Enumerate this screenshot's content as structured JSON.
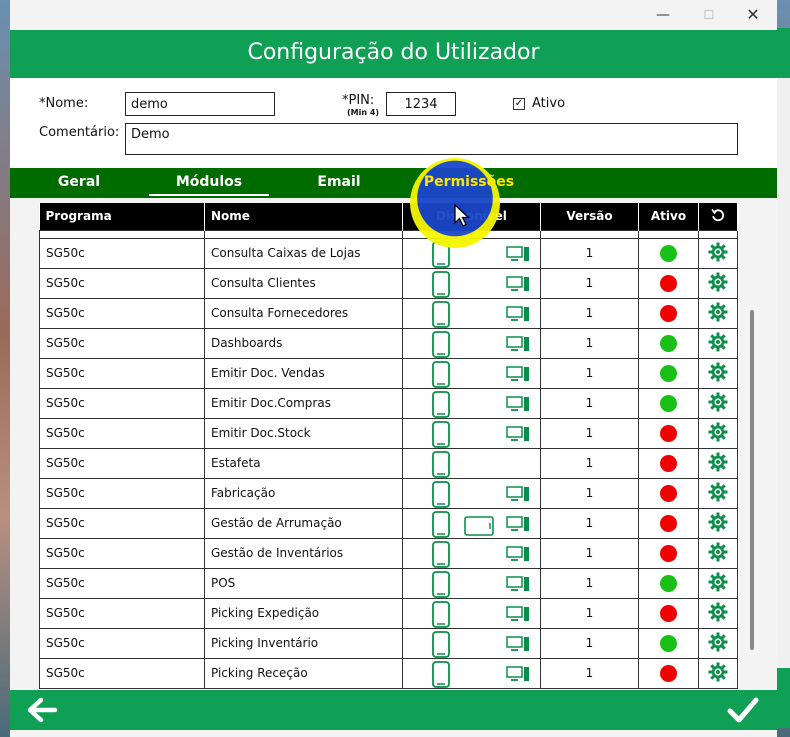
{
  "window": {
    "title": "Configuração do Utilizador",
    "min_glyph": "—",
    "max_glyph": "☐",
    "close_glyph": "✕"
  },
  "form": {
    "nome_label": "*Nome:",
    "nome_value": "demo",
    "pin_label": "*PIN:",
    "pin_hint": "(Min 4)",
    "pin_value": "1234",
    "ativo_label": "Ativo",
    "ativo_checked": true,
    "ativo_mark": "✓",
    "comentario_label": "Comentário:",
    "comentario_value": "Demo"
  },
  "tabs": [
    {
      "label": "Geral"
    },
    {
      "label": "Módulos"
    },
    {
      "label": "Email"
    },
    {
      "label": "Permissões"
    }
  ],
  "table": {
    "headers": {
      "programa": "Programa",
      "nome": "Nome",
      "disponivel": "Disponível",
      "versao": "Versão",
      "ativo": "Ativo"
    },
    "rows": [
      {
        "programa": "SG50c",
        "nome": "Consulta Caixas de Lojas",
        "tablet": false,
        "desktop": true,
        "versao": "1",
        "ativo": true
      },
      {
        "programa": "SG50c",
        "nome": "Consulta Clientes",
        "tablet": false,
        "desktop": true,
        "versao": "1",
        "ativo": false
      },
      {
        "programa": "SG50c",
        "nome": "Consulta Fornecedores",
        "tablet": false,
        "desktop": true,
        "versao": "1",
        "ativo": false
      },
      {
        "programa": "SG50c",
        "nome": "Dashboards",
        "tablet": false,
        "desktop": true,
        "versao": "1",
        "ativo": true
      },
      {
        "programa": "SG50c",
        "nome": "Emitir Doc. Vendas",
        "tablet": false,
        "desktop": true,
        "versao": "1",
        "ativo": true
      },
      {
        "programa": "SG50c",
        "nome": "Emitir Doc.Compras",
        "tablet": false,
        "desktop": true,
        "versao": "1",
        "ativo": true
      },
      {
        "programa": "SG50c",
        "nome": "Emitir Doc.Stock",
        "tablet": false,
        "desktop": true,
        "versao": "1",
        "ativo": false
      },
      {
        "programa": "SG50c",
        "nome": "Estafeta",
        "tablet": false,
        "desktop": false,
        "versao": "1",
        "ativo": false
      },
      {
        "programa": "SG50c",
        "nome": "Fabricação",
        "tablet": false,
        "desktop": true,
        "versao": "1",
        "ativo": false
      },
      {
        "programa": "SG50c",
        "nome": "Gestão de Arrumação",
        "tablet": true,
        "desktop": true,
        "versao": "1",
        "ativo": false
      },
      {
        "programa": "SG50c",
        "nome": "Gestão de Inventários",
        "tablet": false,
        "desktop": true,
        "versao": "1",
        "ativo": false
      },
      {
        "programa": "SG50c",
        "nome": "POS",
        "tablet": false,
        "desktop": true,
        "versao": "1",
        "ativo": true
      },
      {
        "programa": "SG50c",
        "nome": "Picking Expedição",
        "tablet": false,
        "desktop": true,
        "versao": "1",
        "ativo": false
      },
      {
        "programa": "SG50c",
        "nome": "Picking Inventário",
        "tablet": false,
        "desktop": true,
        "versao": "1",
        "ativo": true
      },
      {
        "programa": "SG50c",
        "nome": "Picking Receção",
        "tablet": false,
        "desktop": true,
        "versao": "1",
        "ativo": false
      }
    ]
  },
  "colors": {
    "header_green": "#0fa055",
    "tab_green": "#006c00",
    "active_on": "#18c018",
    "active_off": "#f00000",
    "icon_green": "#0a8f4a",
    "highlight_tab": "#ffe600"
  }
}
